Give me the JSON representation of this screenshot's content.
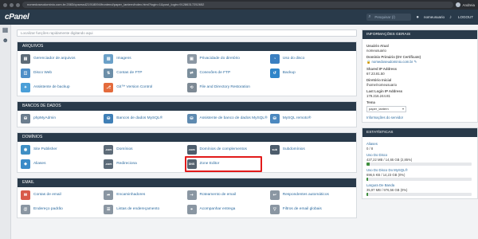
{
  "browser": {
    "url": "nomedoseudominio.com.br:2083/cpsess421918094/frontend/paper_lantern/index.html?login=1&post_login=91286317252652",
    "profile_name": "Andreia"
  },
  "topbar": {
    "logo": "cPanel",
    "search_placeholder": "Pesquisar (/)",
    "user": "nomeusuario",
    "logout": "LOGOUT"
  },
  "main": {
    "search_placeholder": "Localizar funções rapidamente digitando aqui",
    "sections": [
      {
        "title": "ARQUIVOS",
        "items": [
          {
            "label": "Gerenciador de arquivos",
            "icon": "file-manager-icon",
            "color": "#5d6b78",
            "glyph": "▤"
          },
          {
            "label": "Imagens",
            "icon": "images-icon",
            "color": "#6aa0c8",
            "glyph": "▧"
          },
          {
            "label": "Privacidade do diretório",
            "icon": "directory-privacy-icon",
            "color": "#8b97a3",
            "glyph": "▣"
          },
          {
            "label": "Uso do disco",
            "icon": "disk-usage-icon",
            "color": "#3a7fc1",
            "glyph": "◔"
          },
          {
            "label": "Disco Web",
            "icon": "web-disk-icon",
            "color": "#4e8ec7",
            "glyph": "◫"
          },
          {
            "label": "Contas de FTP",
            "icon": "ftp-accounts-icon",
            "color": "#6c8ea8",
            "glyph": "⇅"
          },
          {
            "label": "Conexões de FTP",
            "icon": "ftp-connections-icon",
            "color": "#7b8e9c",
            "glyph": "⇄"
          },
          {
            "label": "Backup",
            "icon": "backup-icon",
            "color": "#2f85c9",
            "glyph": "↺"
          },
          {
            "label": "Assistente de backup",
            "icon": "backup-wizard-icon",
            "color": "#4a9fd8",
            "glyph": "✦"
          },
          {
            "label": "Git™ Version Control",
            "icon": "git-icon",
            "color": "#e46b3c",
            "glyph": "⎇"
          },
          {
            "label": "File and Directory Restoration",
            "icon": "file-restoration-icon",
            "color": "#7d8994",
            "glyph": "⟲"
          }
        ]
      },
      {
        "title": "BANCOS DE DADOS",
        "items": [
          {
            "label": "phpMyAdmin",
            "icon": "phpmyadmin-icon",
            "color": "#6b7d8e",
            "glyph": "⛁"
          },
          {
            "label": "Bancos de dados MySQL®",
            "icon": "mysql-databases-icon",
            "color": "#3f7fb6",
            "glyph": "⛁"
          },
          {
            "label": "Assistente de banco de dados MySQL®",
            "icon": "mysql-wizard-icon",
            "color": "#5e8ab0",
            "glyph": "⛁"
          },
          {
            "label": "MySQL remoto®",
            "icon": "remote-mysql-icon",
            "color": "#4b88bf",
            "glyph": "⛁"
          }
        ]
      },
      {
        "title": "DOMÍNIOS",
        "items": [
          {
            "label": "Site Publisher",
            "icon": "site-publisher-icon",
            "color": "#3f8fc4",
            "glyph": "◉"
          },
          {
            "label": "Domínios",
            "icon": "domains-icon",
            "color": "#5d6b78",
            "glyph": ".com"
          },
          {
            "label": "Domínios de complementos",
            "icon": "addon-domains-icon",
            "color": "#4d5d6c",
            "glyph": ".com"
          },
          {
            "label": "Subdomínios",
            "icon": "subdomains-icon",
            "color": "#4d5d6c",
            "glyph": "sub"
          },
          {
            "label": "Aliases",
            "icon": "aliases-icon",
            "color": "#3a8bc8",
            "glyph": "◈"
          },
          {
            "label": "Redireciona",
            "icon": "redirects-icon",
            "color": "#5b6a78",
            "glyph": ".com"
          },
          {
            "label": "Zone Editor",
            "icon": "zone-editor-icon",
            "color": "#55626f",
            "glyph": "DNS",
            "highlighted": true
          }
        ]
      },
      {
        "title": "EMAIL",
        "items": [
          {
            "label": "Contas de email",
            "icon": "email-accounts-icon",
            "color": "#d85a4a",
            "glyph": "✉"
          },
          {
            "label": "Encaminhadores",
            "icon": "forwarders-icon",
            "color": "#8a96a2",
            "glyph": "➦"
          },
          {
            "label": "Roteamento de email",
            "icon": "email-routing-icon",
            "color": "#8a96a2",
            "glyph": "⇢"
          },
          {
            "label": "Respondentes automáticos",
            "icon": "autoresponders-icon",
            "color": "#8a96a2",
            "glyph": "↩"
          },
          {
            "label": "Endereço padrão",
            "icon": "default-address-icon",
            "color": "#8a96a2",
            "glyph": "@"
          },
          {
            "label": "Listas de endereçamento",
            "icon": "mailing-lists-icon",
            "color": "#8a96a2",
            "glyph": "☰"
          },
          {
            "label": "Acompanhar entrega",
            "icon": "track-delivery-icon",
            "color": "#8a96a2",
            "glyph": "⌖"
          },
          {
            "label": "Filtros de email globais",
            "icon": "global-filters-icon",
            "color": "#8a96a2",
            "glyph": "▽"
          }
        ]
      }
    ]
  },
  "general_info": {
    "title": "INFORMAÇÕES GERAIS",
    "current_user_label": "Usuário Atual",
    "current_user": "nomeusuario",
    "primary_domain_label": "Domínio Primário (DV Certificate)",
    "primary_domain": "nomedoseudominio.com.br",
    "shared_ip_label": "Shared IP Address",
    "shared_ip": "67.23.81.50",
    "home_dir_label": "Diretório Inicial",
    "home_dir": "/home/nomeusuario",
    "last_login_label": "Last Login IP Address",
    "last_login": "179.216.244.81",
    "theme_label": "Tema",
    "theme_value": "paper_lantern",
    "server_info_link": "Informações do servidor"
  },
  "stats": {
    "title": "ESTATÍSTICAS",
    "items": [
      {
        "label": "Aliases",
        "value": "0 / 8",
        "fill": 0
      },
      {
        "label": "Uso Do Disco",
        "value": "427,22 MB / 14,65 GB  (2,85%)",
        "fill": 0.0285
      },
      {
        "label": "Uso Do Disco Do MySQL®",
        "value": "696,5 KB / 14,23 GB  (0%)",
        "fill": 0
      },
      {
        "label": "Largura De Banda",
        "value": "35,97 MB / 976,56 GB  (0%)",
        "fill": 0.0004
      }
    ]
  }
}
